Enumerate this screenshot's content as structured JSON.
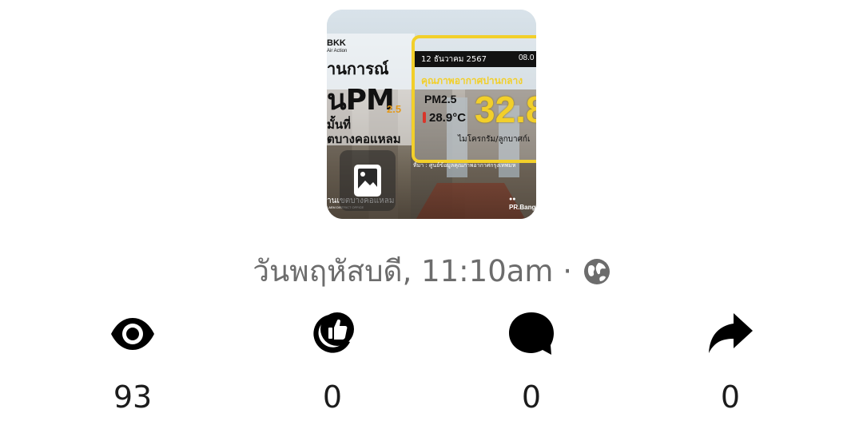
{
  "post": {
    "thumbnail": {
      "brand": "BKK",
      "brand_tagline": "Air Action",
      "headline_line1": "านการณ์",
      "headline_line2": "นPM",
      "headline_pm_sub": "2.5",
      "headline_line3": "มั้นที่",
      "headline_line4": "ตบางคอแหลม",
      "panel_date": "12 ธันวาคม 2567",
      "panel_time": "08.0",
      "panel_title": "คุณภาพอากาศปานกลาง",
      "panel_metric": "PM2.5",
      "panel_temperature": "28.9°C",
      "panel_value": "32.8",
      "panel_unit": "ไมโครกรัม/ลูกบาศก์เ",
      "source_text": "ที่มา : ศูนย์ข้อมูลคุณภาพอากาศกรุงเทพมห",
      "district_text": "านเขตบางคอแหลม",
      "district_sub": "LAEM DISTRICT OFFICE",
      "pr_name": "PR.Bangk",
      "badge_icon": "image-icon",
      "panel_color": "#f2cf2a"
    },
    "timestamp": "วันพฤหัสบดี, 11:10am",
    "separator": "·",
    "privacy_icon": "globe-icon"
  },
  "stats": {
    "views": {
      "icon": "eye-icon",
      "count": "93"
    },
    "reactions": {
      "icon": "thumbs-up-icon",
      "count": "0"
    },
    "comments": {
      "icon": "comment-bubble-icon",
      "count": "0"
    },
    "shares": {
      "icon": "share-arrow-icon",
      "count": "0"
    }
  },
  "colors": {
    "icon": "#000000",
    "meta_text": "#6c6c6c",
    "count_text": "#1c1c1c"
  }
}
